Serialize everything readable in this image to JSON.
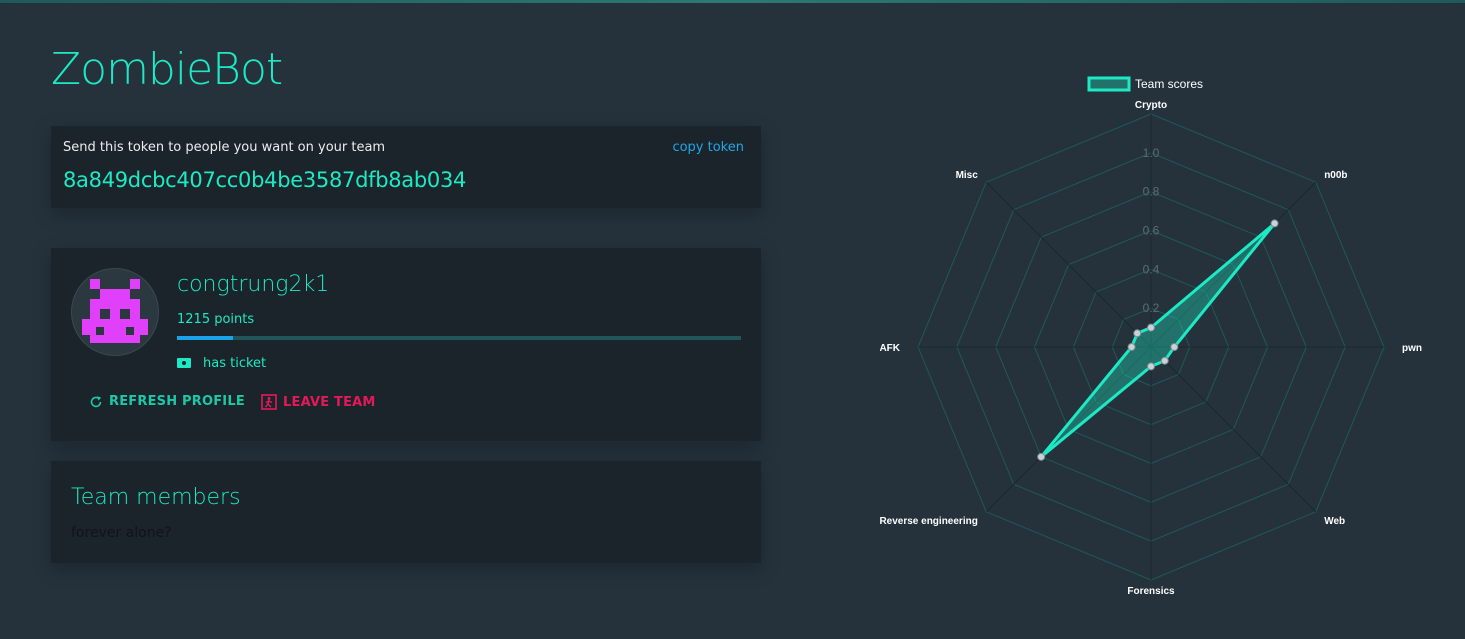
{
  "team": {
    "name": "ZombieBot"
  },
  "token_card": {
    "label": "Send this token to people you want on your team",
    "copy_label": "copy token",
    "token": "8a849dcbc407cc0b4be3587dfb8ab034"
  },
  "profile": {
    "username": "congtrung2k1",
    "points_text": "1215 points",
    "progress": 0.1,
    "ticket_label": "has ticket",
    "refresh_label": "REFRESH PROFILE",
    "leave_label": "LEAVE TEAM",
    "avatar_icon": "pixel-skull-icon",
    "avatar_color": "#e040fb"
  },
  "members": {
    "title": "Team members",
    "empty_text": "forever alone?"
  },
  "colors": {
    "accent": "#1de9c4",
    "link": "#1ea7e8",
    "danger": "#e3195a",
    "background": "#25323c",
    "card": "#1b242b"
  },
  "chart_data": {
    "type": "radar",
    "legend": "Team scores",
    "legend_position": "top",
    "categories": [
      "Crypto",
      "n00b",
      "pwn",
      "Web",
      "Forensics",
      "Reverse engineering",
      "AFK",
      "Misc"
    ],
    "values": [
      0.1,
      0.9,
      0.12,
      0.1,
      0.1,
      0.8,
      0.1,
      0.1
    ],
    "rlim": [
      0,
      1.0
    ],
    "ticks": [
      "0.2",
      "0.4",
      "0.6",
      "0.8",
      "1.0"
    ]
  }
}
